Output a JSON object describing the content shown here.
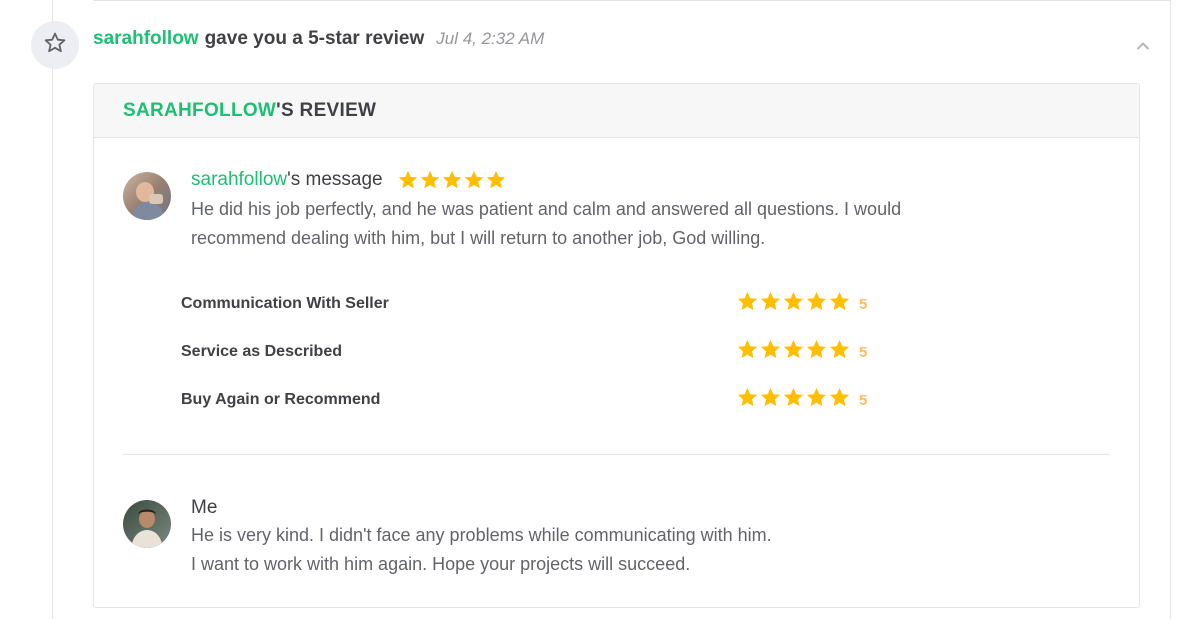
{
  "notification": {
    "username": "sarahfollow",
    "action_text": "gave you a 5-star review",
    "timestamp": "Jul 4, 2:32 AM",
    "icon": "star-outline-icon",
    "collapse_icon": "chevron-up-icon"
  },
  "review_card": {
    "title_username": "SARAHFOLLOW",
    "title_suffix": "'S REVIEW",
    "buyer_message": {
      "username": "sarahfollow",
      "title_suffix": "'s message",
      "rating": 5,
      "lines": [
        "He did his job perfectly, and he was patient and calm and answered all questions. I would",
        "recommend dealing with him, but I will return to another job, God willing."
      ]
    },
    "ratings": [
      {
        "label": "Communication With Seller",
        "stars": 5,
        "value": "5"
      },
      {
        "label": "Service as Described",
        "stars": 5,
        "value": "5"
      },
      {
        "label": "Buy Again or Recommend",
        "stars": 5,
        "value": "5"
      }
    ],
    "seller_response": {
      "author": "Me",
      "lines": [
        "He is very kind. I didn't face any problems while communicating with him.",
        "I want to work with him again. Hope your projects will succeed."
      ]
    }
  },
  "colors": {
    "accent_green": "#1dbf73",
    "star_gold": "#ffbe00",
    "rating_number": "#ffbe5b"
  }
}
